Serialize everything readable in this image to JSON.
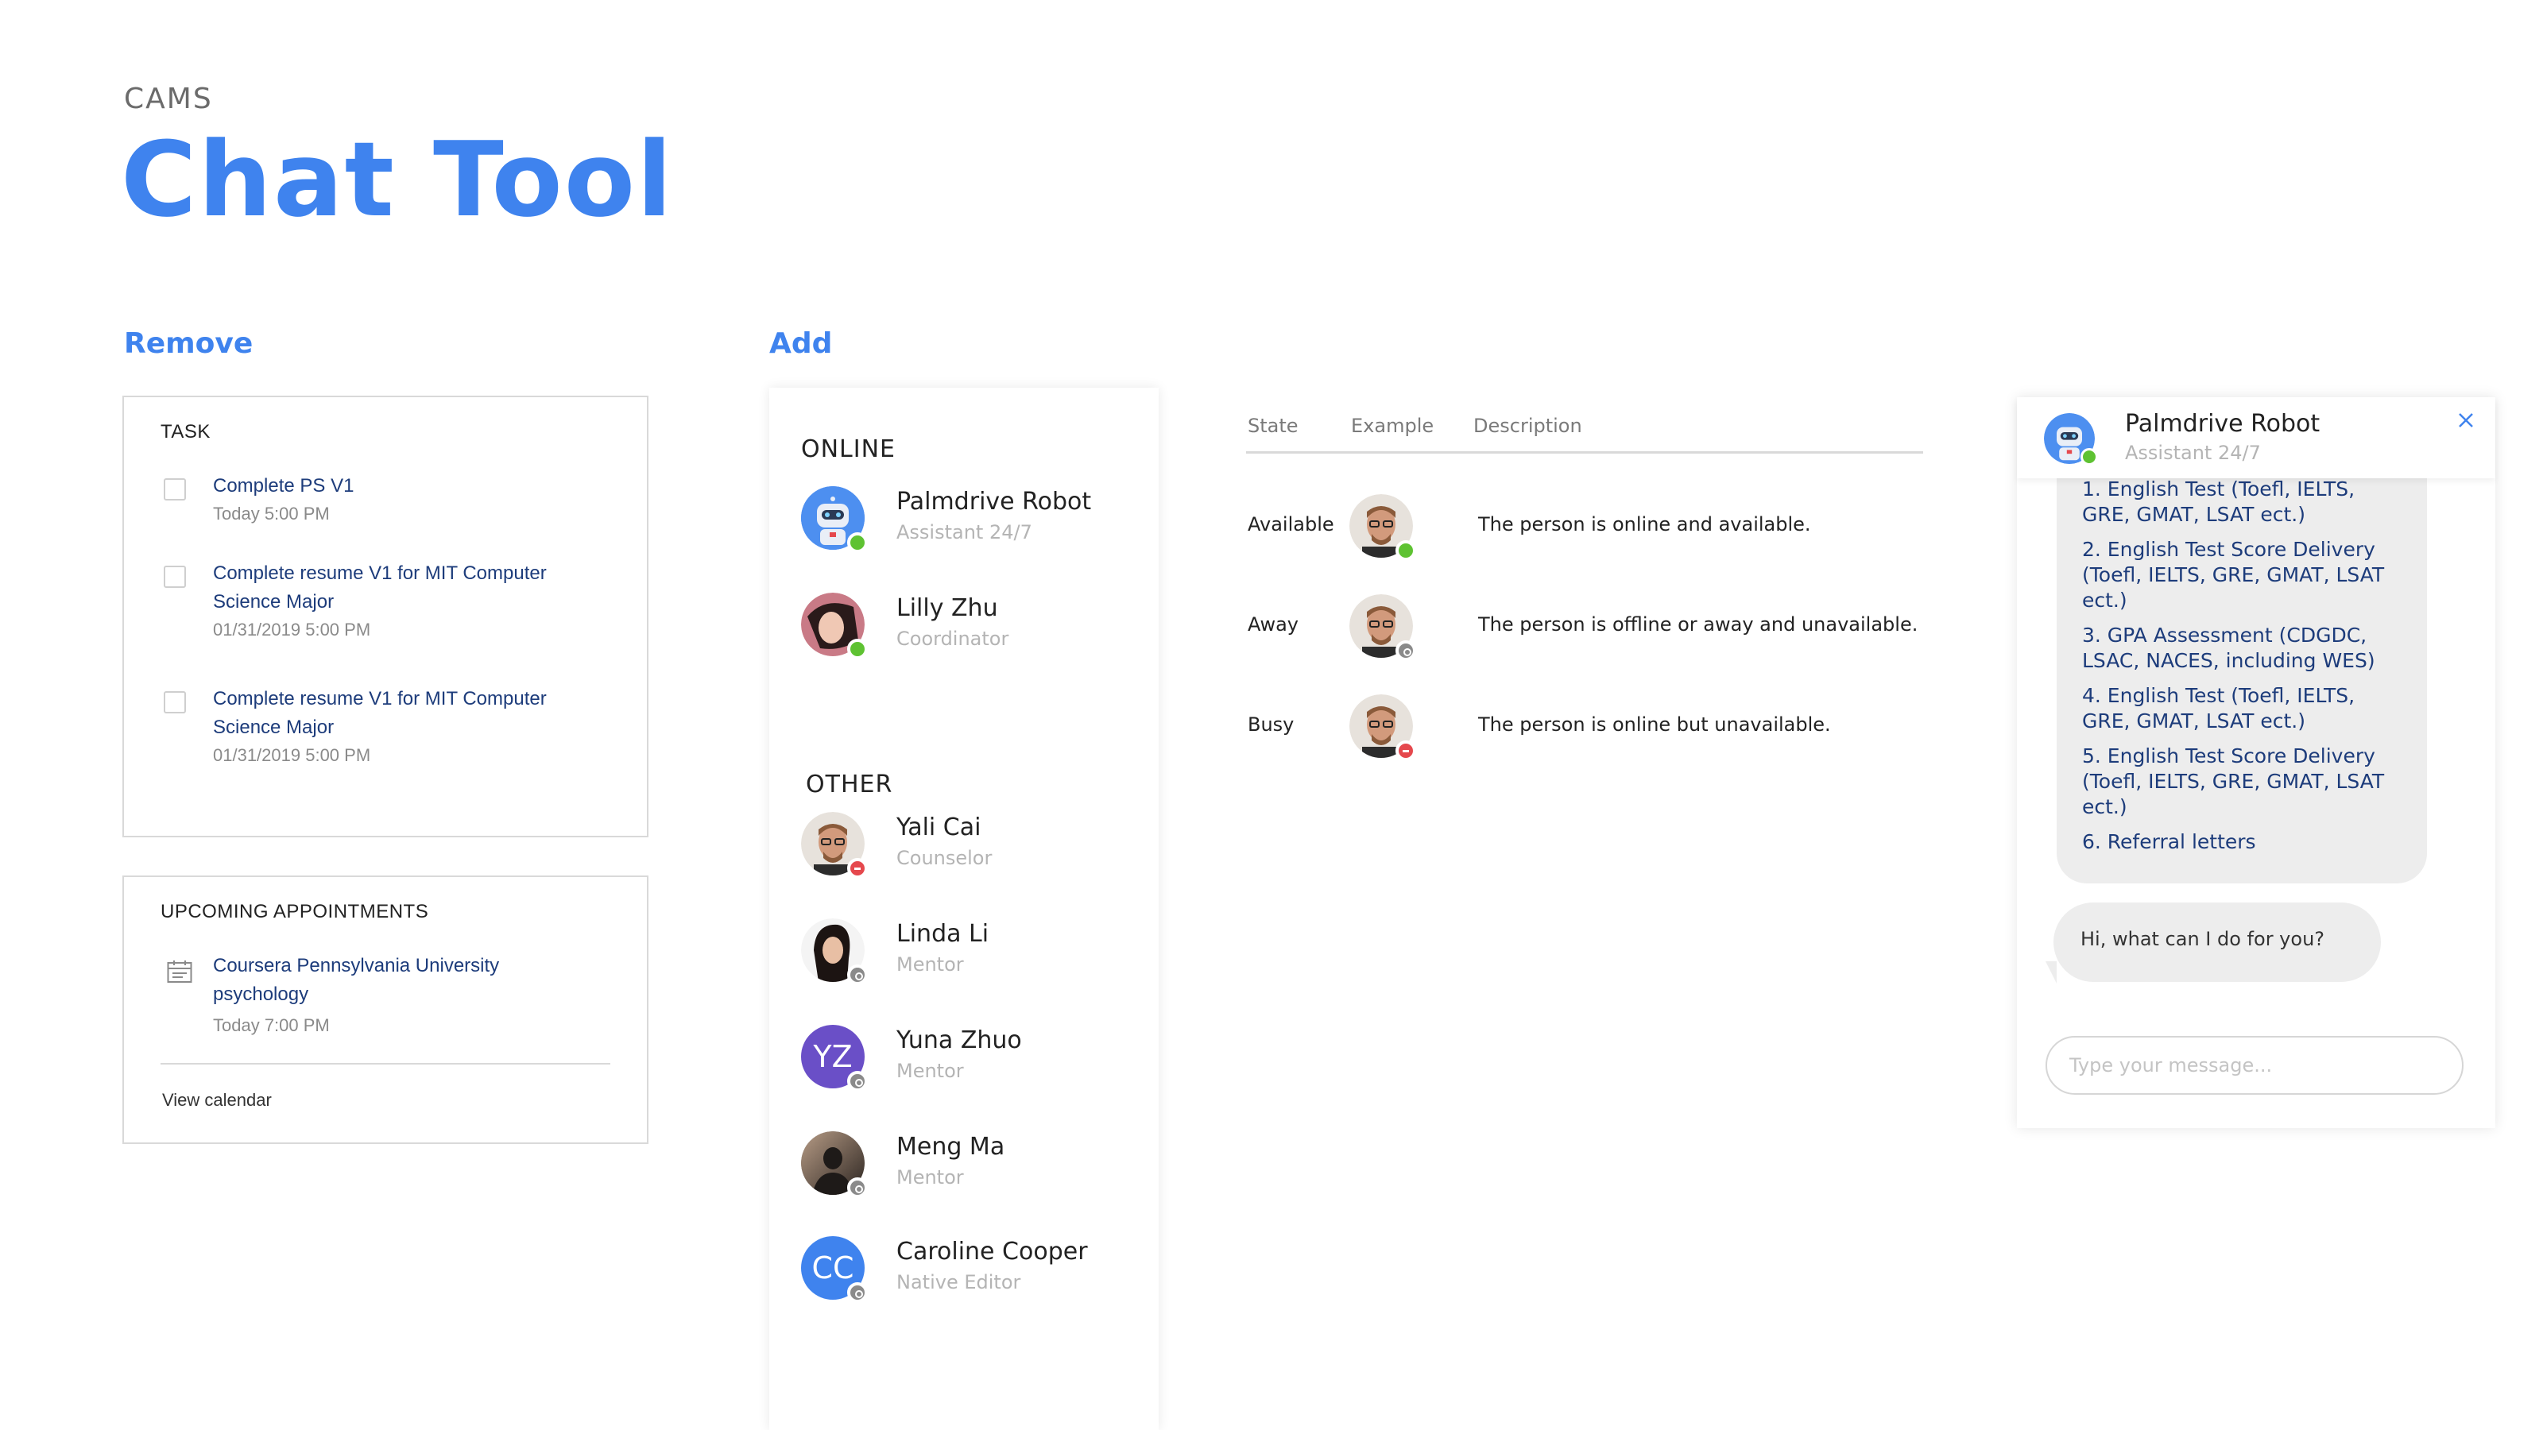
{
  "header": {
    "eyebrow": "CAMS",
    "title": "Chat Tool"
  },
  "remove": {
    "heading": "Remove",
    "task_card": {
      "title": "TASK",
      "tasks": [
        {
          "title_lines": [
            "Complete PS V1"
          ],
          "due": "Today 5:00 PM"
        },
        {
          "title_lines": [
            "Complete resume V1 for MIT Computer",
            "Science Major"
          ],
          "due": "01/31/2019 5:00 PM"
        },
        {
          "title_lines": [
            "Complete resume V1 for MIT Computer",
            "Science Major"
          ],
          "due": "01/31/2019 5:00 PM"
        }
      ]
    },
    "appointments_card": {
      "title": "UPCOMING APPOINTMENTS",
      "item": {
        "title_lines": [
          "Coursera Pennsylvania University",
          "psychology"
        ],
        "time": "Today 7:00 PM",
        "icon": "calendar-icon"
      },
      "link": "View calendar"
    }
  },
  "add": {
    "heading": "Add",
    "online_heading": "ONLINE",
    "other_heading": "OTHER",
    "online": [
      {
        "name": "Palmdrive Robot",
        "role": "Assistant 24/7",
        "status": "available",
        "avatar": "robot"
      },
      {
        "name": "Lilly Zhu",
        "role": "Coordinator",
        "status": "available",
        "avatar": "photo"
      }
    ],
    "other": [
      {
        "name": "Yali Cai",
        "role": "Counselor",
        "status": "busy",
        "avatar": "photo"
      },
      {
        "name": "Linda Li",
        "role": "Mentor",
        "status": "away",
        "avatar": "photo"
      },
      {
        "name": "Yuna Zhuo",
        "role": "Mentor",
        "status": "away",
        "avatar": "initials",
        "initials": "YZ",
        "color": "#6a4fc7"
      },
      {
        "name": "Meng Ma",
        "role": "Mentor",
        "status": "away",
        "avatar": "photo"
      },
      {
        "name": "Caroline Cooper",
        "role": "Native Editor",
        "status": "away",
        "avatar": "initials",
        "initials": "CC",
        "color": "#3f83ee"
      }
    ]
  },
  "states_table": {
    "headers": [
      "State",
      "Example",
      "Description"
    ],
    "rows": [
      {
        "state": "Available",
        "status": "available",
        "description": "The person is online and available."
      },
      {
        "state": "Away",
        "status": "away",
        "description": "The person is offline or away and unavailable."
      },
      {
        "state": "Busy",
        "status": "busy",
        "description": "The person is online but unavailable."
      }
    ]
  },
  "chat": {
    "name": "Palmdrive Robot",
    "role": "Assistant 24/7",
    "close_icon": "close-icon",
    "options": [
      [
        "1. English Test (Toefl, IELTS,",
        "GRE, GMAT, LSAT ect.)"
      ],
      [
        "2. English Test Score Delivery",
        "(Toefl, IELTS, GRE, GMAT, LSAT",
        "ect.)"
      ],
      [
        "3. GPA Assessment (CDGDC,",
        "LSAC, NACES, including WES)"
      ],
      [
        "4. English Test (Toefl, IELTS,",
        "GRE, GMAT, LSAT ect.)"
      ],
      [
        "5. English Test Score Delivery",
        "(Toefl, IELTS, GRE, GMAT, LSAT",
        "ect.)"
      ],
      [
        "6. Referral letters"
      ]
    ],
    "greeting": "Hi, what can I do for you?",
    "input_placeholder": "Type your message..."
  },
  "colors": {
    "accent": "#3f83ee",
    "available": "#5ec232",
    "away": "#8a8a8a",
    "busy": "#e5484d"
  }
}
